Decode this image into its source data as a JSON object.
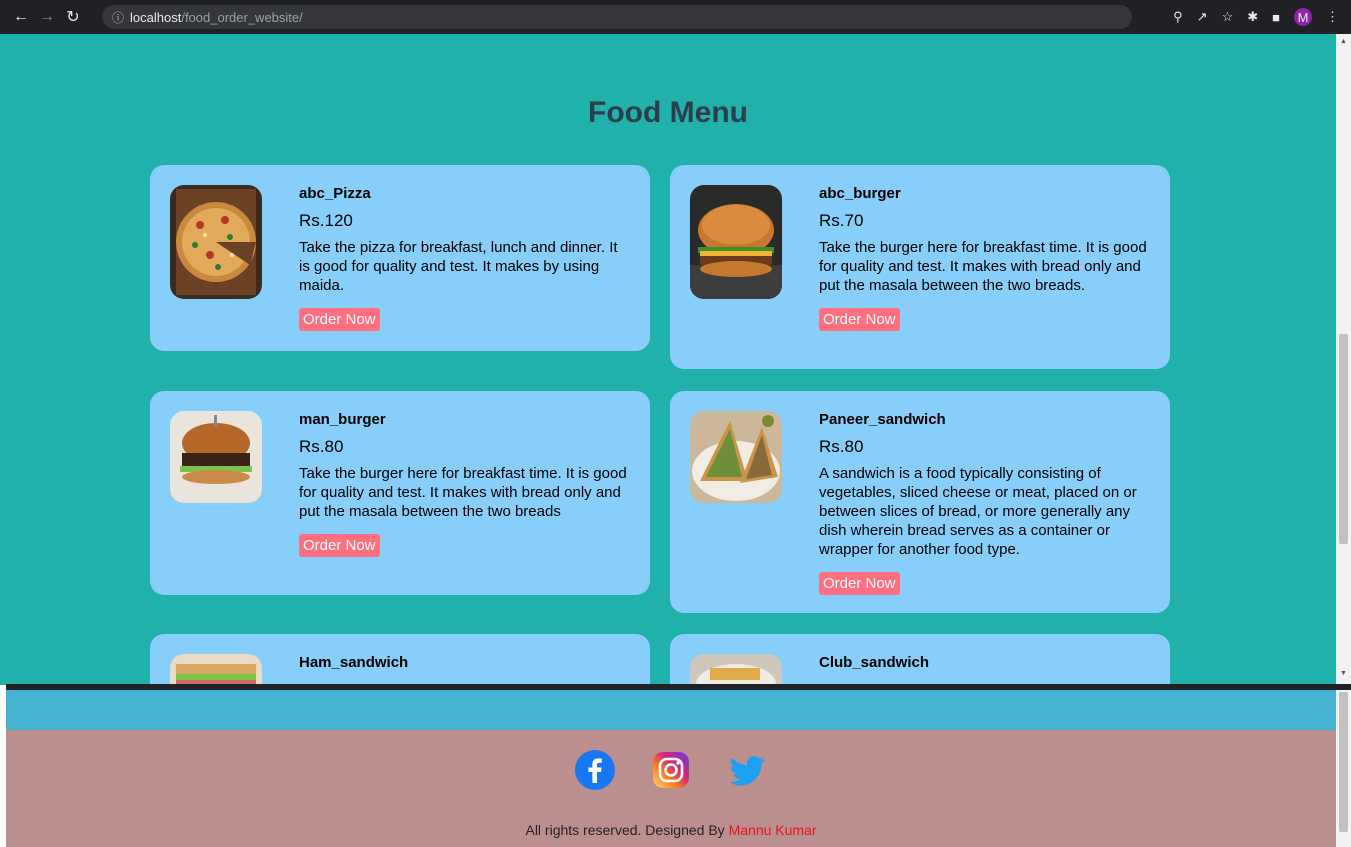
{
  "browser": {
    "url_host": "localhost",
    "url_path": "/food_order_website/",
    "profile_initial": "M"
  },
  "page": {
    "title": "Food Menu"
  },
  "menu": [
    {
      "name": "abc_Pizza",
      "price": "Rs.120",
      "description": "Take the pizza for breakfast, lunch and dinner. It is good for quality and test. It makes by using maida.",
      "button": "Order Now"
    },
    {
      "name": "abc_burger",
      "price": "Rs.70",
      "description": "Take the burger here for breakfast time. It is good for quality and test. It makes with bread only and put the masala between the two breads.",
      "button": "Order Now"
    },
    {
      "name": "man_burger",
      "price": "Rs.80",
      "description": "Take the burger here for breakfast time. It is good for quality and test. It makes with bread only and put the masala between the two breads",
      "button": "Order Now"
    },
    {
      "name": "Paneer_sandwich",
      "price": "Rs.80",
      "description": "A sandwich is a food typically consisting of vegetables, sliced cheese or meat, placed on or between slices of bread, or more generally any dish wherein bread serves as a container or wrapper for another food type.",
      "button": "Order Now"
    },
    {
      "name": "Ham_sandwich"
    },
    {
      "name": "Club_sandwich"
    }
  ],
  "footer": {
    "text": "All rights reserved. Designed By",
    "author": "Mannu Kumar",
    "socials": [
      "facebook-icon",
      "instagram-icon",
      "twitter-icon"
    ]
  },
  "colors": {
    "page_bg": "#20b2aa",
    "card_bg": "#87cefa",
    "button_bg": "#ff6f7f",
    "footer_bg": "#bc8f8f",
    "band_bg": "#45b3d0"
  }
}
